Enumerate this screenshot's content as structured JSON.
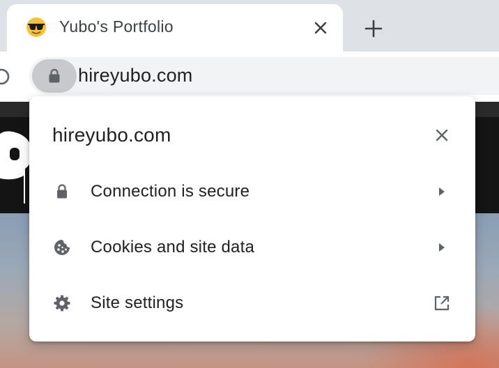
{
  "browser": {
    "tab": {
      "title": "Yubo's Portfolio",
      "favicon": "smiling-face-with-sunglasses-emoji"
    },
    "omnibox": {
      "url": "hireyubo.com",
      "security_icon": "lock-icon"
    }
  },
  "site_info_popup": {
    "title": "hireyubo.com",
    "rows": [
      {
        "label": "Connection is secure",
        "icon": "lock-icon",
        "trailing_icon": "chevron-right-icon"
      },
      {
        "label": "Cookies and site data",
        "icon": "cookie-icon",
        "trailing_icon": "chevron-right-icon"
      },
      {
        "label": "Site settings",
        "icon": "gear-icon",
        "trailing_icon": "external-link-icon"
      }
    ]
  },
  "colors": {
    "popup_icon": "#5f6368",
    "tabstrip": "#dee1e6",
    "omnibox_bg": "#f1f3f4",
    "lock_chip_bg": "#c7c9cc"
  }
}
